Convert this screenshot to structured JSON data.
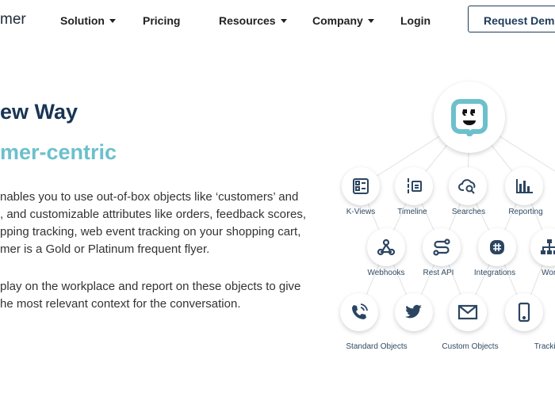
{
  "nav": {
    "logo": "mer",
    "items": [
      {
        "label": "Solution",
        "dropdown": true
      },
      {
        "label": "Pricing",
        "dropdown": false
      },
      {
        "label": "Resources",
        "dropdown": true
      },
      {
        "label": "Company",
        "dropdown": true
      },
      {
        "label": "Login",
        "dropdown": false
      }
    ],
    "cta": "Request Demo"
  },
  "hero": {
    "title": "ew Way",
    "subtitle": "mer-centric",
    "para1": [
      "nables you to use out-of-box objects like ‘customers’ and",
      ", and customizable attributes like orders, feedback scores,",
      "pping tracking, web event tracking on your shopping cart,",
      "mer is a Gold or Platinum frequent flyer."
    ],
    "para2": [
      "play on the workplace and report on these objects to give",
      "he most relevant context for the conversation."
    ]
  },
  "diagram": {
    "center_icon": "smiley-chat-logo-icon",
    "nodes": [
      {
        "label": "K-Views",
        "icon": "kviews-icon"
      },
      {
        "label": "Timeline",
        "icon": "timeline-icon"
      },
      {
        "label": "Searches",
        "icon": "cloud-search-icon"
      },
      {
        "label": "Reporting",
        "icon": "bar-chart-icon"
      },
      {
        "label": "Webhooks",
        "icon": "webhook-icon"
      },
      {
        "label": "Rest API",
        "icon": "api-icon"
      },
      {
        "label": "Integrations",
        "icon": "slack-icon"
      },
      {
        "label": "Workf",
        "icon": "sitemap-icon"
      },
      {
        "label": "",
        "icon": "phone-icon"
      },
      {
        "label": "",
        "icon": "twitter-icon"
      },
      {
        "label": "",
        "icon": "mail-icon"
      },
      {
        "label": "",
        "icon": "mobile-icon"
      }
    ],
    "bottom_labels": [
      "Standard Objects",
      "Custom Objects",
      "Trackin"
    ]
  },
  "colors": {
    "navy": "#183553",
    "teal": "#6cc0cc",
    "icon": "#2b4561"
  }
}
